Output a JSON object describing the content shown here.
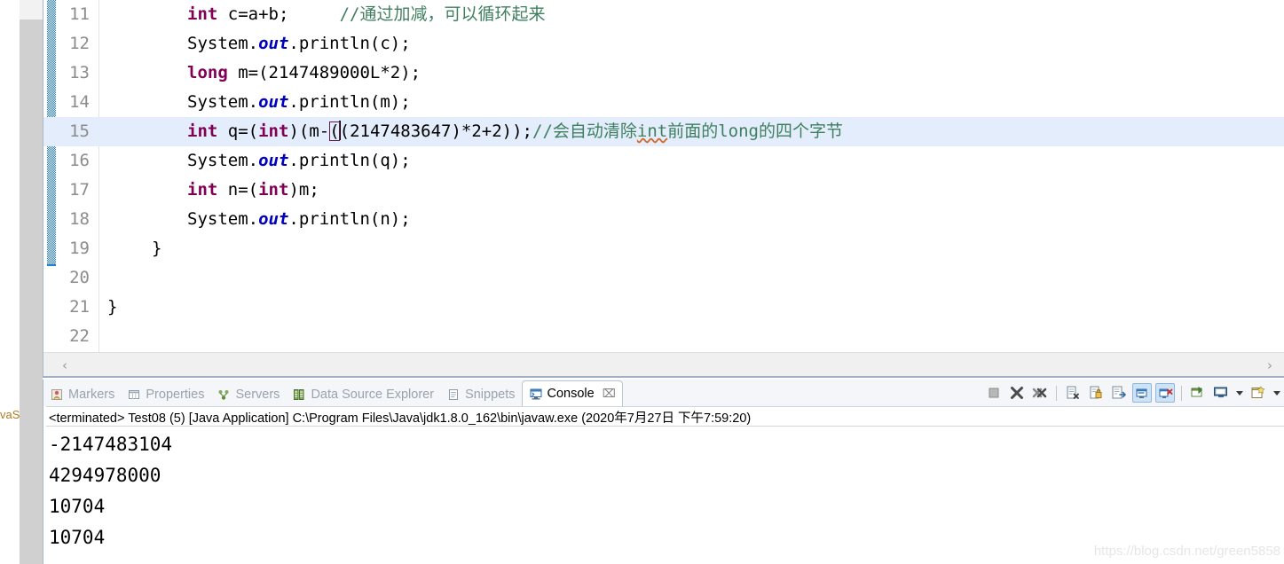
{
  "left_panel": {
    "vertical_label": "vaS"
  },
  "editor": {
    "lines": [
      {
        "number": "11",
        "changed": true,
        "current": false,
        "tokens": [
          {
            "t": "int",
            "c": "kw"
          },
          {
            "t": " c=a+b;",
            "c": "plain"
          },
          {
            "t": "     ",
            "c": "plain"
          },
          {
            "t": "//通过加减，可以循环起来",
            "c": "cmt"
          }
        ]
      },
      {
        "number": "12",
        "changed": true,
        "current": false,
        "tokens": [
          {
            "t": "System.",
            "c": "plain"
          },
          {
            "t": "out",
            "c": "fld"
          },
          {
            "t": ".println(c);",
            "c": "plain"
          }
        ]
      },
      {
        "number": "13",
        "changed": true,
        "current": false,
        "tokens": [
          {
            "t": "long",
            "c": "kw"
          },
          {
            "t": " m=(2147489000L*2);",
            "c": "plain"
          }
        ]
      },
      {
        "number": "14",
        "changed": true,
        "current": false,
        "tokens": [
          {
            "t": "System.",
            "c": "plain"
          },
          {
            "t": "out",
            "c": "fld"
          },
          {
            "t": ".println(m);",
            "c": "plain"
          }
        ]
      },
      {
        "number": "15",
        "changed": true,
        "current": true,
        "tokens": [
          {
            "t": "int",
            "c": "kw"
          },
          {
            "t": " q=",
            "c": "plain"
          },
          {
            "t": "(",
            "c": "plain"
          },
          {
            "t": "int",
            "c": "kw"
          },
          {
            "t": ")(m-",
            "c": "plain"
          },
          {
            "t": "(",
            "c": "brace"
          },
          {
            "t": "(2147483647)*2+2));",
            "c": "plain"
          },
          {
            "t": "//会自动清除",
            "c": "cmt"
          },
          {
            "t": "int",
            "c": "cmt-und"
          },
          {
            "t": "前面的long的四个字节",
            "c": "cmt"
          }
        ]
      },
      {
        "number": "16",
        "changed": true,
        "current": false,
        "tokens": [
          {
            "t": "System.",
            "c": "plain"
          },
          {
            "t": "out",
            "c": "fld"
          },
          {
            "t": ".println(q);",
            "c": "plain"
          }
        ]
      },
      {
        "number": "17",
        "changed": true,
        "current": false,
        "tokens": [
          {
            "t": "int",
            "c": "kw"
          },
          {
            "t": " n=",
            "c": "plain"
          },
          {
            "t": "(",
            "c": "plain"
          },
          {
            "t": "int",
            "c": "kw"
          },
          {
            "t": ")m;",
            "c": "plain"
          }
        ]
      },
      {
        "number": "18",
        "changed": true,
        "current": false,
        "tokens": [
          {
            "t": "System.",
            "c": "plain"
          },
          {
            "t": "out",
            "c": "fld"
          },
          {
            "t": ".println(n);",
            "c": "plain"
          }
        ]
      },
      {
        "number": "19",
        "changed": true,
        "current": false,
        "indent": 1,
        "tokens": [
          {
            "t": "}",
            "c": "plain"
          }
        ]
      },
      {
        "number": "20",
        "changed": false,
        "current": false,
        "tokens": []
      },
      {
        "number": "21",
        "changed": false,
        "current": false,
        "indent": 0,
        "tokens": [
          {
            "t": "}",
            "c": "plain"
          }
        ]
      },
      {
        "number": "22",
        "changed": false,
        "current": false,
        "tokens": []
      }
    ],
    "hscroll": {
      "left_arrow": "‹",
      "right_arrow": "›"
    }
  },
  "console_view": {
    "tabs": [
      {
        "label": "Markers",
        "icon": "markers-icon",
        "active": false,
        "closable": false
      },
      {
        "label": "Properties",
        "icon": "properties-icon",
        "active": false,
        "closable": false
      },
      {
        "label": "Servers",
        "icon": "servers-icon",
        "active": false,
        "closable": false
      },
      {
        "label": "Data Source Explorer",
        "icon": "database-icon",
        "active": false,
        "closable": false
      },
      {
        "label": "Snippets",
        "icon": "snippets-icon",
        "active": false,
        "closable": false
      },
      {
        "label": "Console",
        "icon": "console-icon",
        "active": true,
        "closable": true,
        "close_glyph": "⌧"
      }
    ],
    "toolbar": [
      {
        "name": "terminate-button",
        "icon": "stop-square-icon",
        "state": "off"
      },
      {
        "name": "terminate-all-button",
        "icon": "x-icon",
        "state": "off"
      },
      {
        "name": "remove-launch-button",
        "icon": "double-x-icon",
        "state": "off"
      },
      {
        "name": "separator-1",
        "icon": "separator",
        "state": "off"
      },
      {
        "name": "clear-console-button",
        "icon": "clear-console-icon",
        "state": "off"
      },
      {
        "name": "scroll-lock-button",
        "icon": "lock-icon",
        "state": "off"
      },
      {
        "name": "pin-console-button",
        "icon": "pin-console-icon",
        "state": "off"
      },
      {
        "name": "show-console-on-output-button",
        "icon": "console-out-icon",
        "state": "on"
      },
      {
        "name": "show-console-on-error-button",
        "icon": "console-err-icon",
        "state": "on"
      },
      {
        "name": "separator-2",
        "icon": "separator",
        "state": "off"
      },
      {
        "name": "pin-button",
        "icon": "pin-icon",
        "state": "off"
      },
      {
        "name": "display-console-button",
        "icon": "display-console-icon",
        "state": "off"
      },
      {
        "name": "display-console-dropdown",
        "icon": "chevron-down-icon",
        "state": "off"
      },
      {
        "name": "new-console-button",
        "icon": "new-console-icon",
        "state": "off"
      },
      {
        "name": "new-console-dropdown",
        "icon": "chevron-down-icon",
        "state": "off"
      }
    ],
    "terminated_line": "<terminated> Test08 (5) [Java Application] C:\\Program Files\\Java\\jdk1.8.0_162\\bin\\javaw.exe (2020年7月27日 下午7:59:20)",
    "output": [
      "-2147483104",
      "4294978000",
      "10704",
      "10704"
    ]
  },
  "watermark": "https://blog.csdn.net/green5858",
  "colors": {
    "keyword": "#7f0055",
    "field": "#0000c0",
    "comment": "#3f7f5f",
    "current_line": "#e3edfb",
    "change_bar": "#1f7fd4",
    "tab_active_text": "#000000",
    "tab_inactive_text": "#9aa3ad"
  }
}
